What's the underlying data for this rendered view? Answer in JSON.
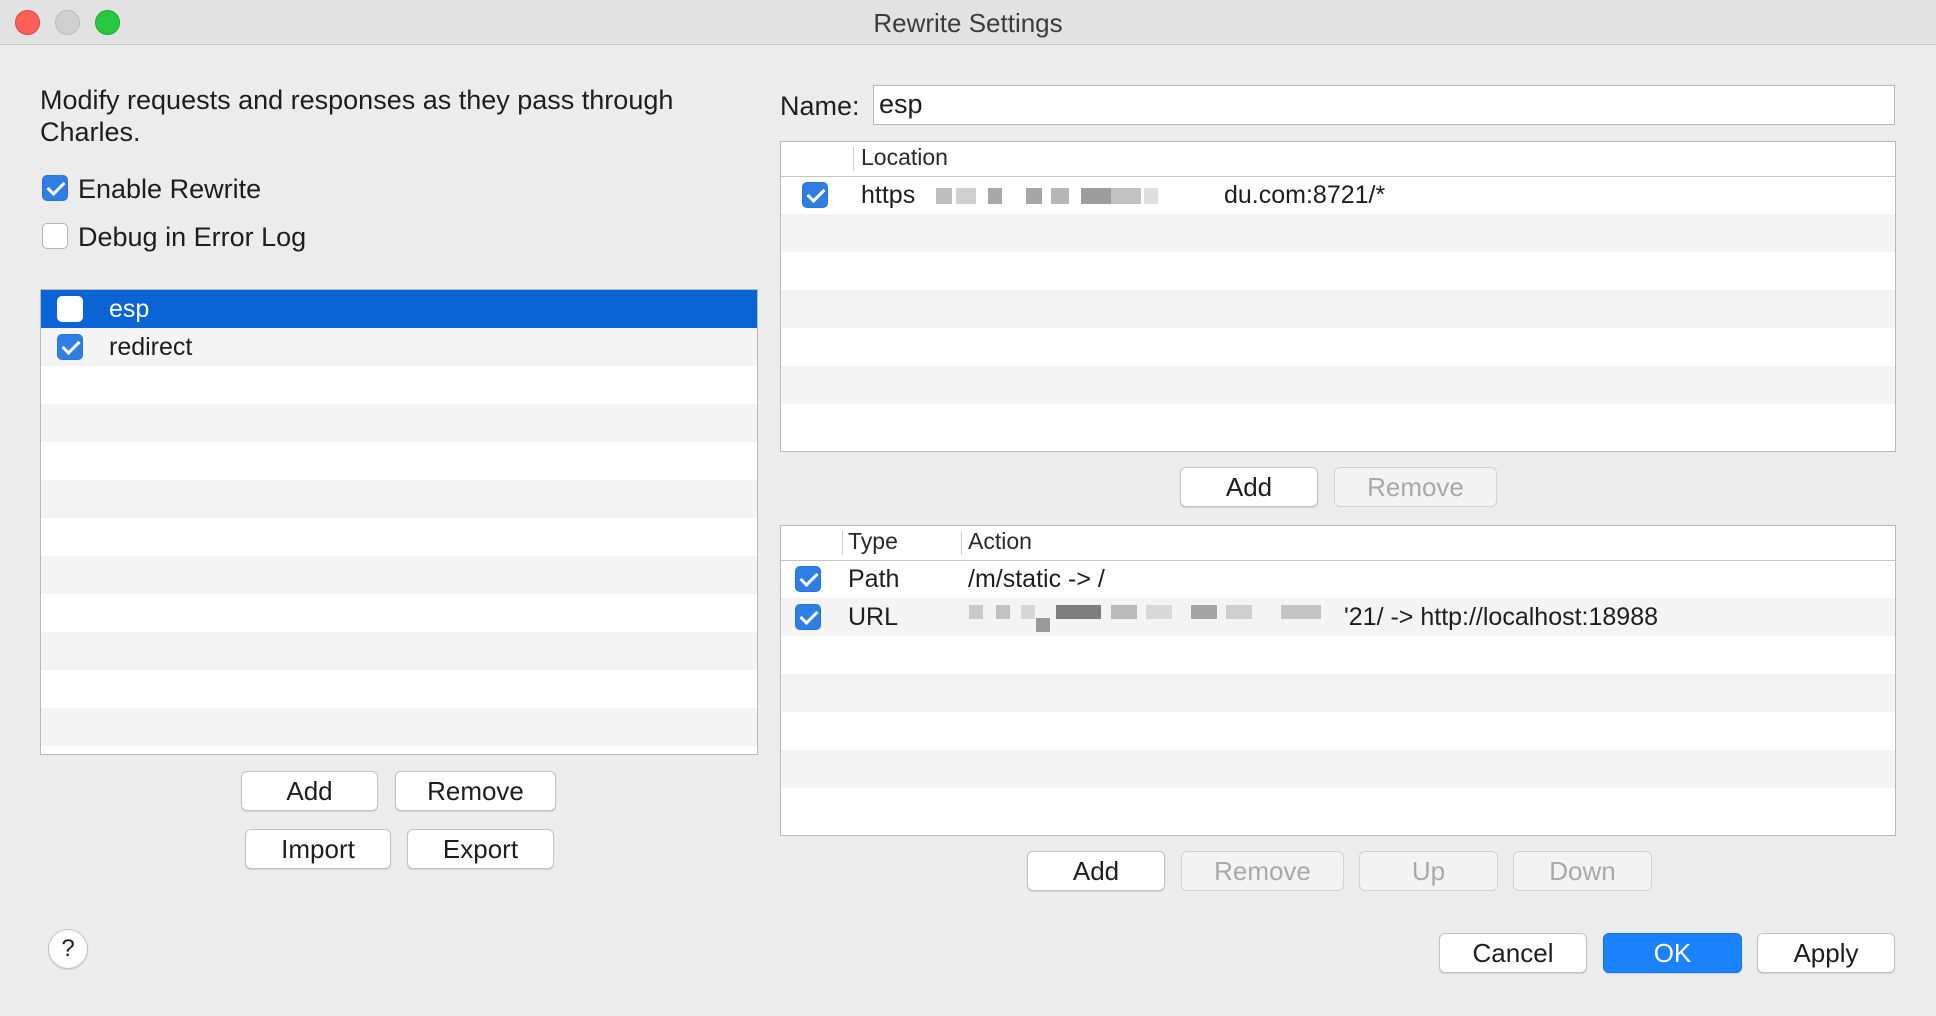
{
  "window": {
    "title": "Rewrite Settings"
  },
  "description": "Modify requests and responses as they pass through Charles.",
  "options": {
    "enable_rewrite": {
      "label": "Enable Rewrite",
      "checked": true
    },
    "debug_log": {
      "label": "Debug in Error Log",
      "checked": false
    }
  },
  "sets": [
    {
      "name": "esp",
      "checked": false,
      "selected": true
    },
    {
      "name": "redirect",
      "checked": true,
      "selected": false
    }
  ],
  "sets_buttons": {
    "add": "Add",
    "remove": "Remove",
    "import": "Import",
    "export": "Export"
  },
  "name_field": {
    "label": "Name:",
    "value": "esp"
  },
  "locations": {
    "header": "Location",
    "rows": [
      {
        "checked": true,
        "prefix": "https",
        "suffix": "du.com:8721/*"
      }
    ],
    "buttons": {
      "add": "Add",
      "remove": "Remove"
    }
  },
  "rules": {
    "headers": {
      "type": "Type",
      "action": "Action"
    },
    "rows": [
      {
        "checked": true,
        "type": "Path",
        "action": "/m/static -> /"
      },
      {
        "checked": true,
        "type": "URL",
        "action": "'21/ -> http://localhost:18988"
      }
    ],
    "buttons": {
      "add": "Add",
      "remove": "Remove",
      "up": "Up",
      "down": "Down"
    }
  },
  "footer": {
    "help": "?",
    "cancel": "Cancel",
    "ok": "OK",
    "apply": "Apply"
  },
  "colors": {
    "accent": "#1a82fb",
    "selection": "#0a64d6",
    "checkbox_on": "#2f7ee6"
  }
}
